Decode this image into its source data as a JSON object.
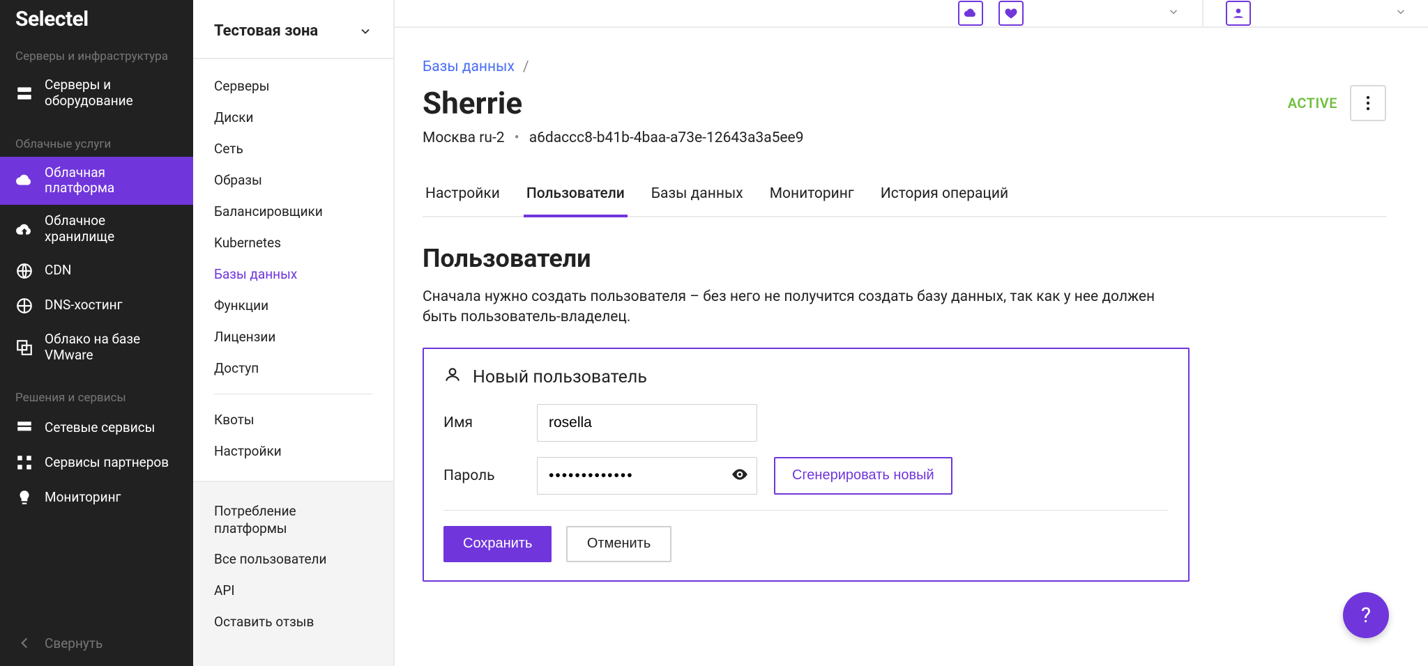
{
  "brand": "Selectel",
  "sidebar": {
    "cat1": "Серверы и инфраструктура",
    "servers_equipment": "Серверы и оборудование",
    "cat2": "Облачные услуги",
    "cloud_platform": "Облачная платформа",
    "cloud_storage": "Облачное хранилище",
    "cdn": "CDN",
    "dns": "DNS-хостинг",
    "vmware": "Облако на базе VMware",
    "cat3": "Решения и сервисы",
    "net_services": "Сетевые сервисы",
    "partner_services": "Сервисы партнеров",
    "monitoring": "Мониторинг",
    "collapse": "Свернуть"
  },
  "project": {
    "name": "Тестовая зона",
    "nav": [
      "Серверы",
      "Диски",
      "Сеть",
      "Образы",
      "Балансировщики",
      "Kubernetes",
      "Базы данных",
      "Функции",
      "Лицензии",
      "Доступ"
    ],
    "nav2": [
      "Квоты",
      "Настройки"
    ],
    "nav3": [
      "Потребление платформы",
      "Все пользователи",
      "API",
      "Оставить отзыв"
    ]
  },
  "breadcrumb": {
    "root": "Базы данных",
    "sep": "/"
  },
  "instance": {
    "name": "Sherrie",
    "status": "ACTIVE",
    "region": "Москва ru-2",
    "uuid": "a6daccc8-b41b-4baa-a73e-12643a3a5ee9"
  },
  "tabs": [
    "Настройки",
    "Пользователи",
    "Базы данных",
    "Мониторинг",
    "История операций"
  ],
  "section": {
    "title": "Пользователи",
    "desc": "Сначала нужно создать пользователя – без него не получится создать базу данных, так как у нее должен быть пользователь-владелец."
  },
  "form": {
    "card_title": "Новый пользователь",
    "name_label": "Имя",
    "name_value": "rosella",
    "pw_label": "Пароль",
    "pw_value": "•••••••••••••",
    "gen_label": "Сгенерировать новый",
    "save": "Сохранить",
    "cancel": "Отменить"
  },
  "fab": "?"
}
